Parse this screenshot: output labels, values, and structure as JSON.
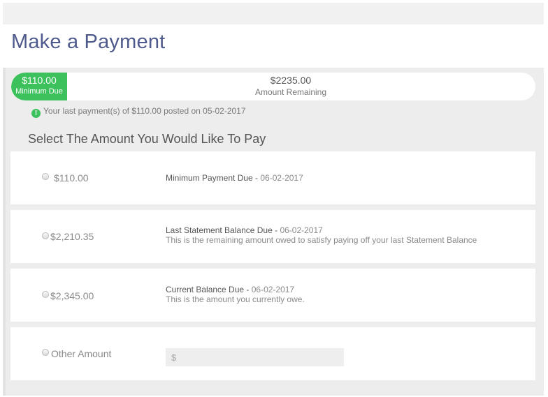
{
  "page": {
    "title": "Make a Payment"
  },
  "progress": {
    "minimum_amount": "$110.00",
    "minimum_label": "Minimum Due",
    "remaining_amount": "$2235.00",
    "remaining_label": "Amount Remaining",
    "paid_fraction": 0.047,
    "fill_color": "#3cc15d"
  },
  "notice": {
    "icon": "exclamation-circle-icon",
    "text": "Your last payment(s) of $110.00 posted on 05-02-2017"
  },
  "section": {
    "heading": "Select The Amount You Would Like To Pay"
  },
  "options": [
    {
      "amount": "$110.00",
      "title": "Minimum Payment Due - ",
      "date": "06-02-2017",
      "subtitle": ""
    },
    {
      "amount": "$2,210.35",
      "title": "Last Statement Balance Due  - ",
      "date": "06-02-2017",
      "subtitle": "This is the remaining amount owed to satisfy paying off your last Statement Balance"
    },
    {
      "amount": "$2,345.00",
      "title": "Current Balance Due  - ",
      "date": "06-02-2017",
      "subtitle": "This is the amount you currently owe."
    },
    {
      "amount": "Other Amount",
      "input_placeholder": "$"
    }
  ]
}
